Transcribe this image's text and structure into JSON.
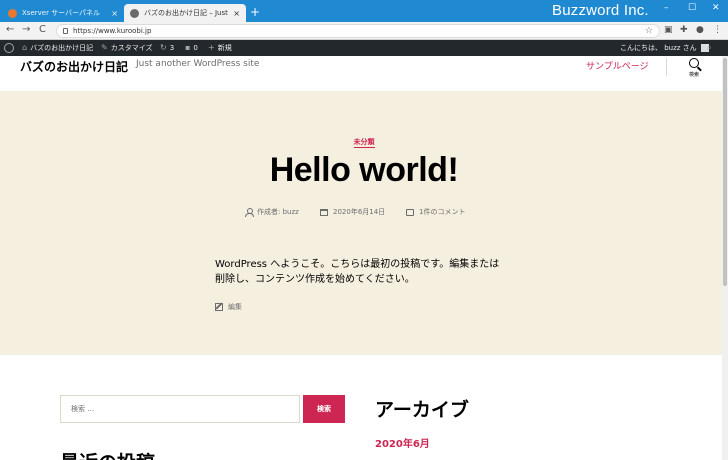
{
  "browser": {
    "tabs": [
      {
        "title": "Xserver サーバーパネル",
        "close": "×"
      },
      {
        "title": "バズのお出かけ日記 – Just another WordPress site",
        "close": "×"
      }
    ],
    "new_tab": "+",
    "brand": "Buzzword Inc.",
    "window_controls": {
      "minimize": "–",
      "maximize": "☐",
      "close": "✕"
    },
    "nav": {
      "back": "←",
      "forward": "→",
      "reload": "C"
    },
    "url": "https://www.kuroobi.jp"
  },
  "admin_bar": {
    "site_name": "バズのお出かけ日記",
    "customize": "カスタマイズ",
    "updates_count": "3",
    "comments_count": "0",
    "new_label": "新規",
    "greeting": "こんにちは、 buzz さん"
  },
  "site": {
    "title": "バズのお出かけ日記",
    "description": "Just another WordPress site",
    "menu_item": "サンプルページ",
    "search_label": "検索"
  },
  "post": {
    "category": "未分類",
    "title": "Hello world!",
    "author": "作成者: buzz",
    "date": "2020年6月14日",
    "comments": "1件のコメント",
    "content": "WordPress へようこそ。こちらは最初の投稿です。編集または削除し、コンテンツ作成を始めてください。",
    "edit_label": "編集"
  },
  "widgets": {
    "search_placeholder": "検索 …",
    "search_button": "検索",
    "archive_title": "アーカイブ",
    "archive_item": "2020年6月",
    "recent_posts_title": "最近の投稿"
  },
  "colors": {
    "accent": "#cd2653",
    "hero_bg": "#f5efe0",
    "admin_bar_bg": "#23282d",
    "titlebar_bg": "#1f8ad2"
  }
}
